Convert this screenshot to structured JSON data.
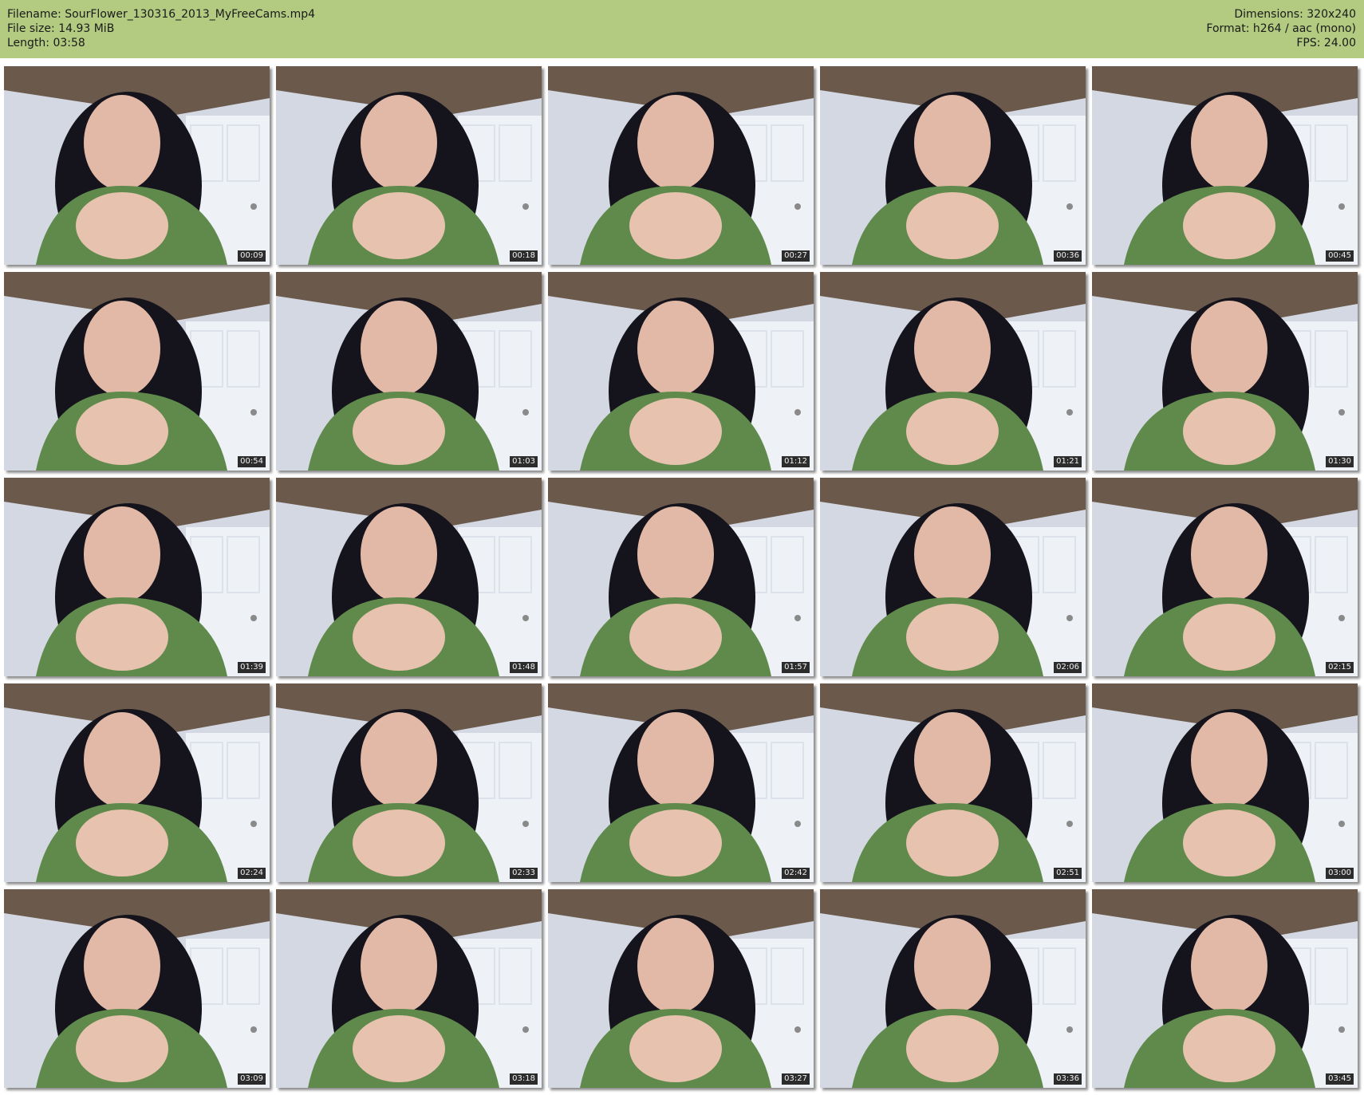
{
  "info": {
    "filename": "Filename: SourFlower_130316_2013_MyFreeCams.mp4",
    "filesize": "File size: 14.93 MiB",
    "length": "Length: 03:58",
    "dimensions": "Dimensions: 320x240",
    "format": "Format: h264 / aac (mono)",
    "fps": "FPS: 24.00"
  },
  "colors": {
    "header_bg": "#b2cb80",
    "timestamp_bg": "#2c2c2c",
    "timestamp_text": "#f2f2f2"
  },
  "thumbnails": [
    {
      "time": "00:09"
    },
    {
      "time": "00:18"
    },
    {
      "time": "00:27"
    },
    {
      "time": "00:36"
    },
    {
      "time": "00:45"
    },
    {
      "time": "00:54"
    },
    {
      "time": "01:03"
    },
    {
      "time": "01:12"
    },
    {
      "time": "01:21"
    },
    {
      "time": "01:30"
    },
    {
      "time": "01:39"
    },
    {
      "time": "01:48"
    },
    {
      "time": "01:57"
    },
    {
      "time": "02:06"
    },
    {
      "time": "02:15"
    },
    {
      "time": "02:24"
    },
    {
      "time": "02:33"
    },
    {
      "time": "02:42"
    },
    {
      "time": "02:51"
    },
    {
      "time": "03:00"
    },
    {
      "time": "03:09"
    },
    {
      "time": "03:18"
    },
    {
      "time": "03:27"
    },
    {
      "time": "03:36"
    },
    {
      "time": "03:45"
    }
  ]
}
